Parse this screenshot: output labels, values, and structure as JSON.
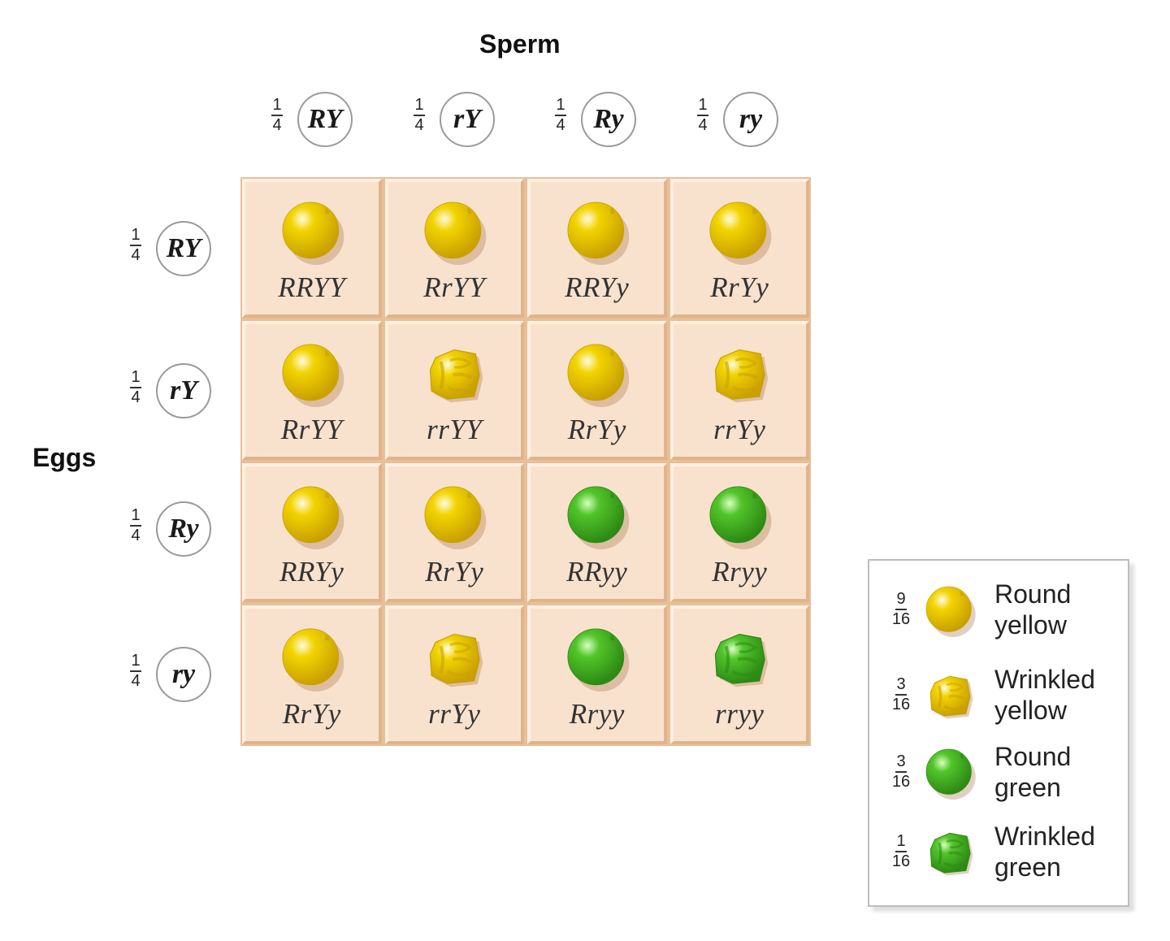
{
  "titles": {
    "sperm": "Sperm",
    "eggs": "Eggs"
  },
  "colors": {
    "yellow": "#f2d400",
    "yellow_dark": "#c9a000",
    "green": "#52c52a",
    "green_dark": "#2d8a14",
    "cell_bg": "#f9e2cd",
    "grid_border": "#e9bf97"
  },
  "sperm": [
    {
      "probability_num": "1",
      "probability_den": "4",
      "allele": "RY"
    },
    {
      "probability_num": "1",
      "probability_den": "4",
      "allele": "rY"
    },
    {
      "probability_num": "1",
      "probability_den": "4",
      "allele": "Ry"
    },
    {
      "probability_num": "1",
      "probability_den": "4",
      "allele": "ry"
    }
  ],
  "eggs": [
    {
      "probability_num": "1",
      "probability_den": "4",
      "allele": "RY"
    },
    {
      "probability_num": "1",
      "probability_den": "4",
      "allele": "rY"
    },
    {
      "probability_num": "1",
      "probability_den": "4",
      "allele": "Ry"
    },
    {
      "probability_num": "1",
      "probability_den": "4",
      "allele": "ry"
    }
  ],
  "grid": [
    [
      {
        "genotype": "RRYY",
        "phenotype": "round-yellow"
      },
      {
        "genotype": "RrYY",
        "phenotype": "round-yellow"
      },
      {
        "genotype": "RRYy",
        "phenotype": "round-yellow"
      },
      {
        "genotype": "RrYy",
        "phenotype": "round-yellow"
      }
    ],
    [
      {
        "genotype": "RrYY",
        "phenotype": "round-yellow"
      },
      {
        "genotype": "rrYY",
        "phenotype": "wrinkled-yellow"
      },
      {
        "genotype": "RrYy",
        "phenotype": "round-yellow"
      },
      {
        "genotype": "rrYy",
        "phenotype": "wrinkled-yellow"
      }
    ],
    [
      {
        "genotype": "RRYy",
        "phenotype": "round-yellow"
      },
      {
        "genotype": "RrYy",
        "phenotype": "round-yellow"
      },
      {
        "genotype": "RRyy",
        "phenotype": "round-green"
      },
      {
        "genotype": "Rryy",
        "phenotype": "round-green"
      }
    ],
    [
      {
        "genotype": "RrYy",
        "phenotype": "round-yellow"
      },
      {
        "genotype": "rrYy",
        "phenotype": "wrinkled-yellow"
      },
      {
        "genotype": "Rryy",
        "phenotype": "round-green"
      },
      {
        "genotype": "rryy",
        "phenotype": "wrinkled-green"
      }
    ]
  ],
  "legend": [
    {
      "num": "9",
      "den": "16",
      "phenotype": "round-yellow",
      "line1": "Round",
      "line2": "yellow"
    },
    {
      "num": "3",
      "den": "16",
      "phenotype": "wrinkled-yellow",
      "line1": "Wrinkled",
      "line2": "yellow"
    },
    {
      "num": "3",
      "den": "16",
      "phenotype": "round-green",
      "line1": "Round",
      "line2": "green"
    },
    {
      "num": "1",
      "den": "16",
      "phenotype": "wrinkled-green",
      "line1": "Wrinkled",
      "line2": "green"
    }
  ]
}
